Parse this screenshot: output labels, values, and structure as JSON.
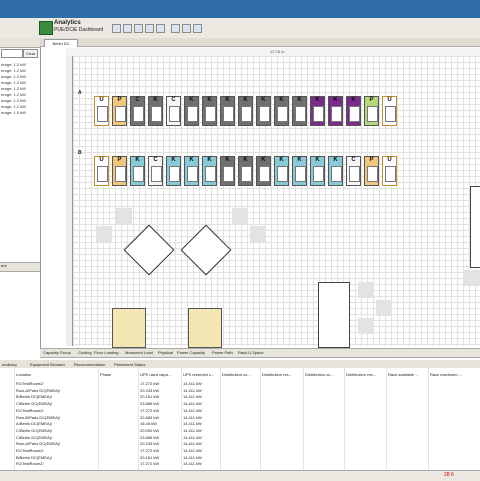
{
  "app": {
    "title": "Analytics",
    "subtitle": "PUE/DCiE Dashboard"
  },
  "left_panel": {
    "clear_label": "Clear",
    "items": [
      "erage: 1.2 kW",
      "erage: 1.2 kW",
      "erage: 1.2 kW",
      "erage: 1.2 kW",
      "erage: 1.2 kW",
      "erage: 1.2 kW",
      "erage: 1.2 kW",
      "erage: 1.2 kW",
      "erage: 1.5 kW"
    ],
    "bottom_header": "ent"
  },
  "main_tab": {
    "label": "Berlin DC"
  },
  "ruler": {
    "text": "13.78 m"
  },
  "floor": {
    "row_a_label": "A",
    "row_b_label": "B",
    "row_a": [
      {
        "l": "U",
        "c": "ups"
      },
      {
        "l": "P",
        "c": "pdu"
      },
      {
        "l": "C",
        "c": "grey"
      },
      {
        "l": "K",
        "c": "grey"
      },
      {
        "l": "C",
        "c": "white"
      },
      {
        "l": "K",
        "c": "grey"
      },
      {
        "l": "K",
        "c": "grey"
      },
      {
        "l": "K",
        "c": "grey"
      },
      {
        "l": "K",
        "c": "grey"
      },
      {
        "l": "K",
        "c": "grey"
      },
      {
        "l": "K",
        "c": "grey"
      },
      {
        "l": "K",
        "c": "grey"
      },
      {
        "l": "K",
        "c": "purple"
      },
      {
        "l": "K",
        "c": "purple"
      },
      {
        "l": "K",
        "c": "purple"
      },
      {
        "l": "P",
        "c": "green"
      },
      {
        "l": "U",
        "c": "ups"
      }
    ],
    "row_b": [
      {
        "l": "U",
        "c": "ups"
      },
      {
        "l": "P",
        "c": "pdu"
      },
      {
        "l": "K",
        "c": "cyan"
      },
      {
        "l": "C",
        "c": "white"
      },
      {
        "l": "K",
        "c": "cyan"
      },
      {
        "l": "K",
        "c": "cyan"
      },
      {
        "l": "K",
        "c": "cyan"
      },
      {
        "l": "K",
        "c": "grey"
      },
      {
        "l": "K",
        "c": "grey"
      },
      {
        "l": "K",
        "c": "grey"
      },
      {
        "l": "K",
        "c": "cyan"
      },
      {
        "l": "K",
        "c": "cyan"
      },
      {
        "l": "K",
        "c": "cyan"
      },
      {
        "l": "K",
        "c": "cyan"
      },
      {
        "l": "C",
        "c": "white"
      },
      {
        "l": "P",
        "c": "pdu"
      },
      {
        "l": "U",
        "c": "ups"
      }
    ]
  },
  "canvas_tabs": [
    "Capacity Group",
    "Cooling",
    "Floor Loading",
    "Measured Load",
    "Physical",
    "Power Capacity",
    "Power Path",
    "Rack U Space"
  ],
  "bottom_tabs": [
    "endency",
    "Equipment Browser",
    "Recommendation",
    "Placement Status"
  ],
  "table": {
    "headers": [
      "Location",
      "Phase",
      "UPS used capa...",
      "UPS reserved c...",
      "Distribution cu...",
      "Distribution res...",
      "Distribution cu...",
      "Distribution res...",
      "Rack available ...",
      "Rack maximum ..."
    ],
    "rows": [
      [
        "R1/TestRoom2/",
        "",
        "17.272 kW",
        "14.411 kW"
      ],
      [
        "Row-A/Paris DC(EMEA)/",
        "",
        "20.233 kW",
        "14.411 kW"
      ],
      [
        "B/Berlin DC(EMEA)/",
        "",
        "20.161 kW",
        "14.411 kW"
      ],
      [
        "C/Berlin DC(EMEA)/",
        "",
        "23.889 kW",
        "14.411 kW"
      ],
      [
        "R1/TestRoom2/",
        "",
        "17.272 kW",
        "14.411 kW"
      ],
      [
        "Row-B/Paris DC(EMEA)/",
        "",
        "22.683 kW",
        "14.411 kW"
      ],
      [
        "A/Berlin DC(EMEA)/",
        "",
        "16.45 kW",
        "14.411 kW"
      ],
      [
        "C/Berlin DC(EMEA)/",
        "",
        "20.092 kW",
        "14.411 kW"
      ],
      [
        "C/Berlin DC(EMEA)/",
        "",
        "23.889 kW",
        "14.411 kW"
      ],
      [
        "Row-A/Paris DC(EMEA)/",
        "",
        "20.233 kW",
        "14.411 kW"
      ],
      [
        "R1/TestRoom2/",
        "",
        "17.272 kW",
        "14.411 kW"
      ],
      [
        "B/Berlin DC(EMEA)/",
        "",
        "20.161 kW",
        "14.411 kW"
      ],
      [
        "R1/TestRoom2/",
        "",
        "17.272 kW",
        "14.411 kW"
      ]
    ]
  },
  "status": {
    "badge": "28 6"
  }
}
